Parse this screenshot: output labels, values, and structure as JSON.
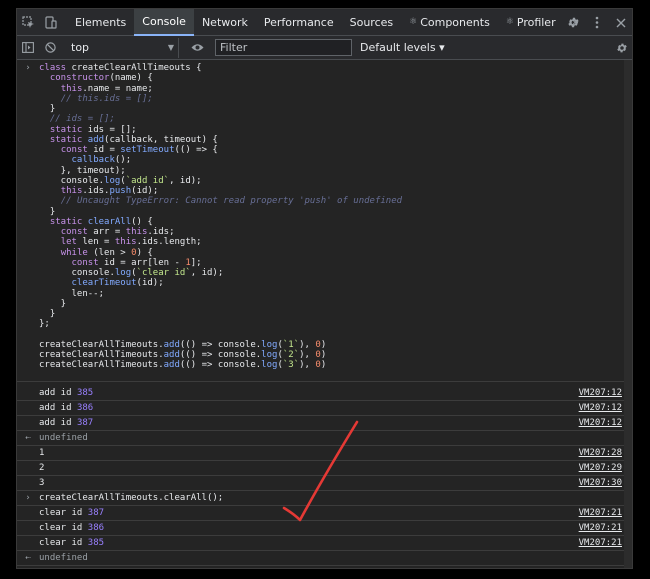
{
  "tabs": [
    {
      "label": "Elements",
      "active": false
    },
    {
      "label": "Console",
      "active": true
    },
    {
      "label": "Network",
      "active": false
    },
    {
      "label": "Performance",
      "active": false
    },
    {
      "label": "Sources",
      "active": false
    },
    {
      "label": "Components",
      "active": false,
      "prefix": "⚛"
    },
    {
      "label": "Profiler",
      "active": false,
      "prefix": "⚛"
    }
  ],
  "tab_more": "»",
  "toolbar": {
    "context": "top",
    "filter_placeholder": "Filter",
    "levels": "Default levels ▾"
  },
  "code_lines": [
    "class createClearAllTimeouts {",
    "  constructor(name) {",
    "    this.name = name;",
    "    // this.ids = [];",
    "  }",
    "  // ids = [];",
    "  static ids = [];",
    "  static add(callback, timeout) {",
    "    const id = setTimeout(() => {",
    "      callback();",
    "    }, timeout);",
    "    console.log(`add id`, id);",
    "    this.ids.push(id);",
    "    // Uncaught TypeError: Cannot read property 'push' of undefined",
    "  }",
    "  static clearAll() {",
    "    const arr = this.ids;",
    "    let len = this.ids.length;",
    "    while (len > 0) {",
    "      const id = arr[len - 1];",
    "      console.log(`clear id`, id);",
    "      clearTimeout(id);",
    "      len--;",
    "    }",
    "  }",
    "};",
    "",
    "createClearAllTimeouts.add(() => console.log(`1`), 0)",
    "createClearAllTimeouts.add(() => console.log(`2`), 0)",
    "createClearAllTimeouts.add(() => console.log(`3`), 0)"
  ],
  "rows": [
    {
      "type": "log",
      "text": "add id ",
      "num": "385",
      "src": "VM207:12"
    },
    {
      "type": "log",
      "text": "add id ",
      "num": "386",
      "src": "VM207:12"
    },
    {
      "type": "log",
      "text": "add id ",
      "num": "387",
      "src": "VM207:12"
    },
    {
      "type": "result",
      "text": "undefined"
    },
    {
      "type": "log",
      "text": "1",
      "src": "VM207:28"
    },
    {
      "type": "log",
      "text": "2",
      "src": "VM207:29"
    },
    {
      "type": "log",
      "text": "3",
      "src": "VM207:30"
    },
    {
      "type": "input",
      "text": "createClearAllTimeouts.clearAll();"
    },
    {
      "type": "log",
      "text": "clear id ",
      "num": "387",
      "src": "VM207:21"
    },
    {
      "type": "log",
      "text": "clear id ",
      "num": "386",
      "src": "VM207:21"
    },
    {
      "type": "log",
      "text": "clear id ",
      "num": "385",
      "src": "VM207:21"
    },
    {
      "type": "result",
      "text": "undefined"
    }
  ],
  "colors": {
    "annotation_check": "#e53935"
  }
}
